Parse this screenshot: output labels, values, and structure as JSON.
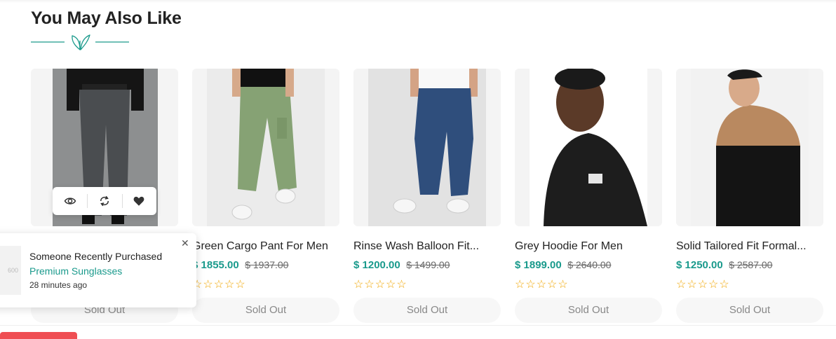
{
  "section": {
    "title": "You May Also Like",
    "divider_icon": "leaf-icon",
    "accent_color": "#1a9a8c"
  },
  "products": [
    {
      "name": "",
      "price": "",
      "old_price": "",
      "rating": 0,
      "stars": "",
      "sold_out_label": "Sold Out",
      "hover_actions": [
        "eye-icon",
        "compare-icon",
        "heart-icon"
      ]
    },
    {
      "name": "Green Cargo Pant For Men",
      "price": "$ 1855.00",
      "old_price": "$ 1937.00",
      "rating": 0,
      "stars": "☆☆☆☆☆",
      "sold_out_label": "Sold Out"
    },
    {
      "name": "Rinse Wash Balloon Fit...",
      "price": "$ 1200.00",
      "old_price": "$ 1499.00",
      "rating": 0,
      "stars": "☆☆☆☆☆",
      "sold_out_label": "Sold Out"
    },
    {
      "name": "Grey Hoodie For Men",
      "price": "$ 1899.00",
      "old_price": "$ 2640.00",
      "rating": 0,
      "stars": "☆☆☆☆☆",
      "sold_out_label": "Sold Out"
    },
    {
      "name": "Solid Tailored Fit Formal...",
      "price": "$ 1250.00",
      "old_price": "$ 2587.00",
      "rating": 0,
      "stars": "☆☆☆☆☆",
      "sold_out_label": "Sold Out"
    }
  ],
  "popup": {
    "title": "Someone Recently Purchased",
    "product": "Premium Sunglasses",
    "time": "28 minutes ago",
    "image_placeholder": "600",
    "close_icon": "close-icon"
  }
}
